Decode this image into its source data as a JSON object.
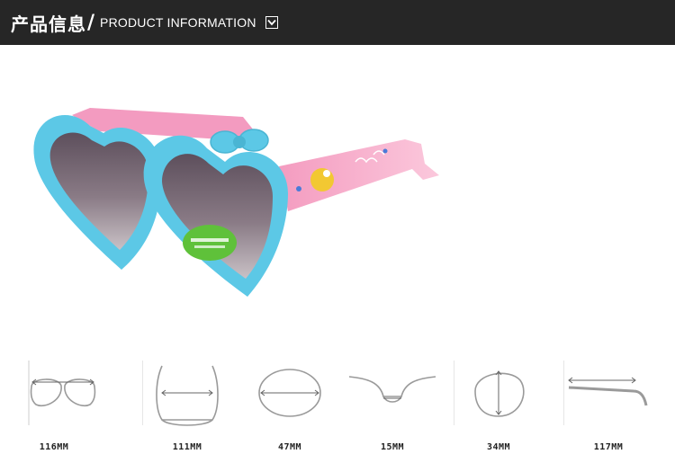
{
  "header": {
    "title_cn": "产品信息",
    "slash": "/",
    "title_en": "PRODUCT INFORMATION",
    "chevron_icon": "chevron-down-icon",
    "background": "#262626"
  },
  "product": {
    "image": "heart-sunglasses-image",
    "frame_color": "#5cc8e6",
    "temple_color": "#f7a8c8",
    "lens_color": "#7a6a78"
  },
  "dimensions": [
    {
      "label": "116MM",
      "icon": "frame-width-icon"
    },
    {
      "label": "111MM",
      "icon": "temple-spread-icon"
    },
    {
      "label": "47MM",
      "icon": "lens-width-icon"
    },
    {
      "label": "15MM",
      "icon": "bridge-width-icon"
    },
    {
      "label": "34MM",
      "icon": "lens-height-icon"
    },
    {
      "label": "117MM",
      "icon": "temple-length-icon"
    }
  ]
}
